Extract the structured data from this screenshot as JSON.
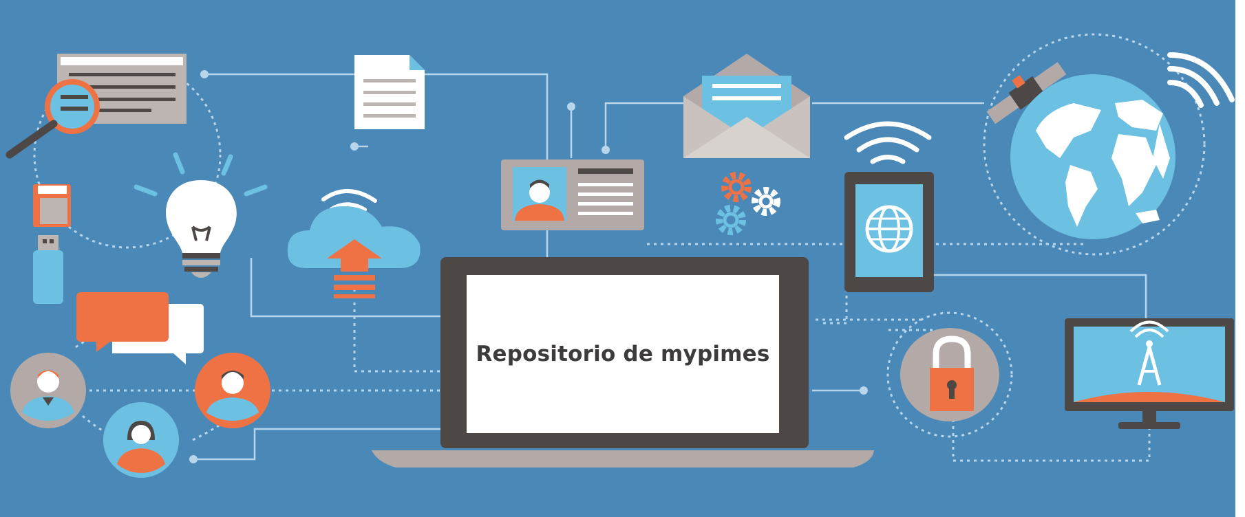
{
  "screen": {
    "title": "Repositorio de mypimes"
  },
  "colors": {
    "background": "#4a88b8",
    "accent_orange": "#ef7245",
    "light_blue": "#6cc0e2",
    "laptop_dark": "#4d4746",
    "laptop_base": "#b3aaa7",
    "line": "#b7d6ec"
  },
  "icons": [
    "document-magnifier-icon",
    "paper-document-icon",
    "mail-envelope-icon",
    "satellite-icon",
    "globe-icon",
    "wifi-signal-icon",
    "lightbulb-icon",
    "sd-card-icon",
    "usb-drive-icon",
    "cloud-upload-icon",
    "id-card-icon",
    "gears-icon",
    "smartphone-icon",
    "chat-bubbles-icon",
    "person-icon",
    "padlock-icon",
    "tv-antenna-icon",
    "laptop-icon"
  ]
}
